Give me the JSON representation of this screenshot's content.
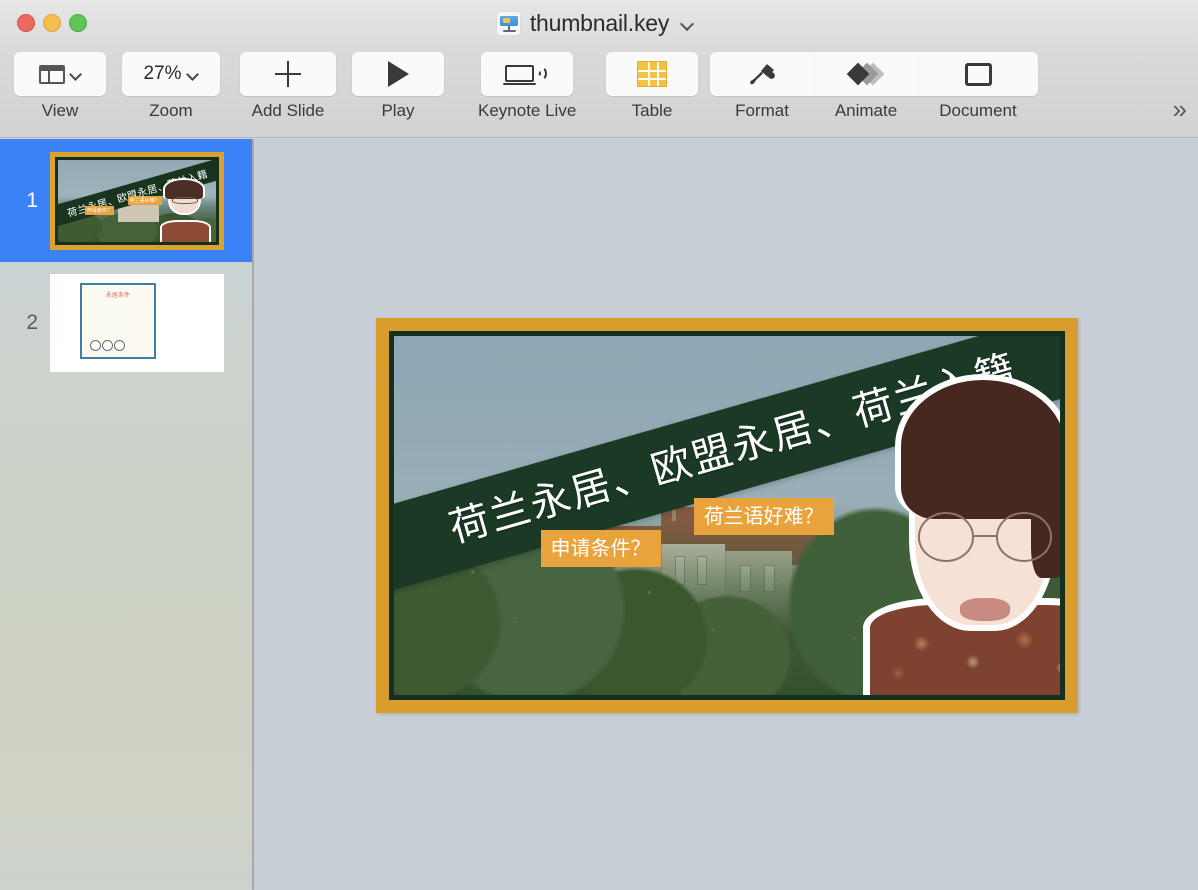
{
  "window": {
    "title": "thumbnail.key",
    "app_icon": "keynote-icon",
    "title_menu_icon": "chevron-down-icon",
    "traffic_lights": {
      "close": "close-button",
      "minimize": "minimize-button",
      "maximize": "maximize-button"
    }
  },
  "toolbar": {
    "items": [
      {
        "label": "View",
        "icon": "panel-layout-icon",
        "has_chevron": true,
        "value": ""
      },
      {
        "label": "Zoom",
        "icon": "zoom-percent-icon",
        "has_chevron": true,
        "value": "27%"
      },
      {
        "label": "Add Slide",
        "icon": "plus-icon",
        "has_chevron": false,
        "value": ""
      },
      {
        "label": "Play",
        "icon": "play-icon",
        "has_chevron": false,
        "value": ""
      },
      {
        "label": "Keynote Live",
        "icon": "broadcast-icon",
        "has_chevron": false,
        "value": ""
      },
      {
        "label": "Table",
        "icon": "table-grid-icon",
        "has_chevron": false,
        "value": ""
      },
      {
        "label": "Format",
        "icon": "paint-brush-icon",
        "has_chevron": false,
        "value": ""
      },
      {
        "label": "Animate",
        "icon": "diamonds-icon",
        "has_chevron": false,
        "value": ""
      },
      {
        "label": "Document",
        "icon": "square-outline-icon",
        "has_chevron": false,
        "value": ""
      }
    ],
    "overflow_label": "»"
  },
  "sidebar": {
    "slides": [
      {
        "number": "1",
        "selected": true,
        "title": "荷兰永居、欧盟永居、荷兰入籍"
      },
      {
        "number": "2",
        "selected": false,
        "title": "永居条件"
      }
    ]
  },
  "slide": {
    "headline": "荷兰永居、欧盟永居、荷兰入籍",
    "tags": [
      {
        "name": "language-tag",
        "text": "荷兰语好难？"
      },
      {
        "name": "condition-tag",
        "text": "申请条件？"
      }
    ],
    "colors": {
      "frame": "#d99d2e",
      "banner": "#1b3a25",
      "tag": "#e8a33d",
      "sky": "#93aab6",
      "foliage": "#3d5a33"
    }
  },
  "colors": {
    "selection_blue": "#3b82f6",
    "canvas_bg": "#c8ced5",
    "toolbar_bg": "#d6d6d6"
  }
}
